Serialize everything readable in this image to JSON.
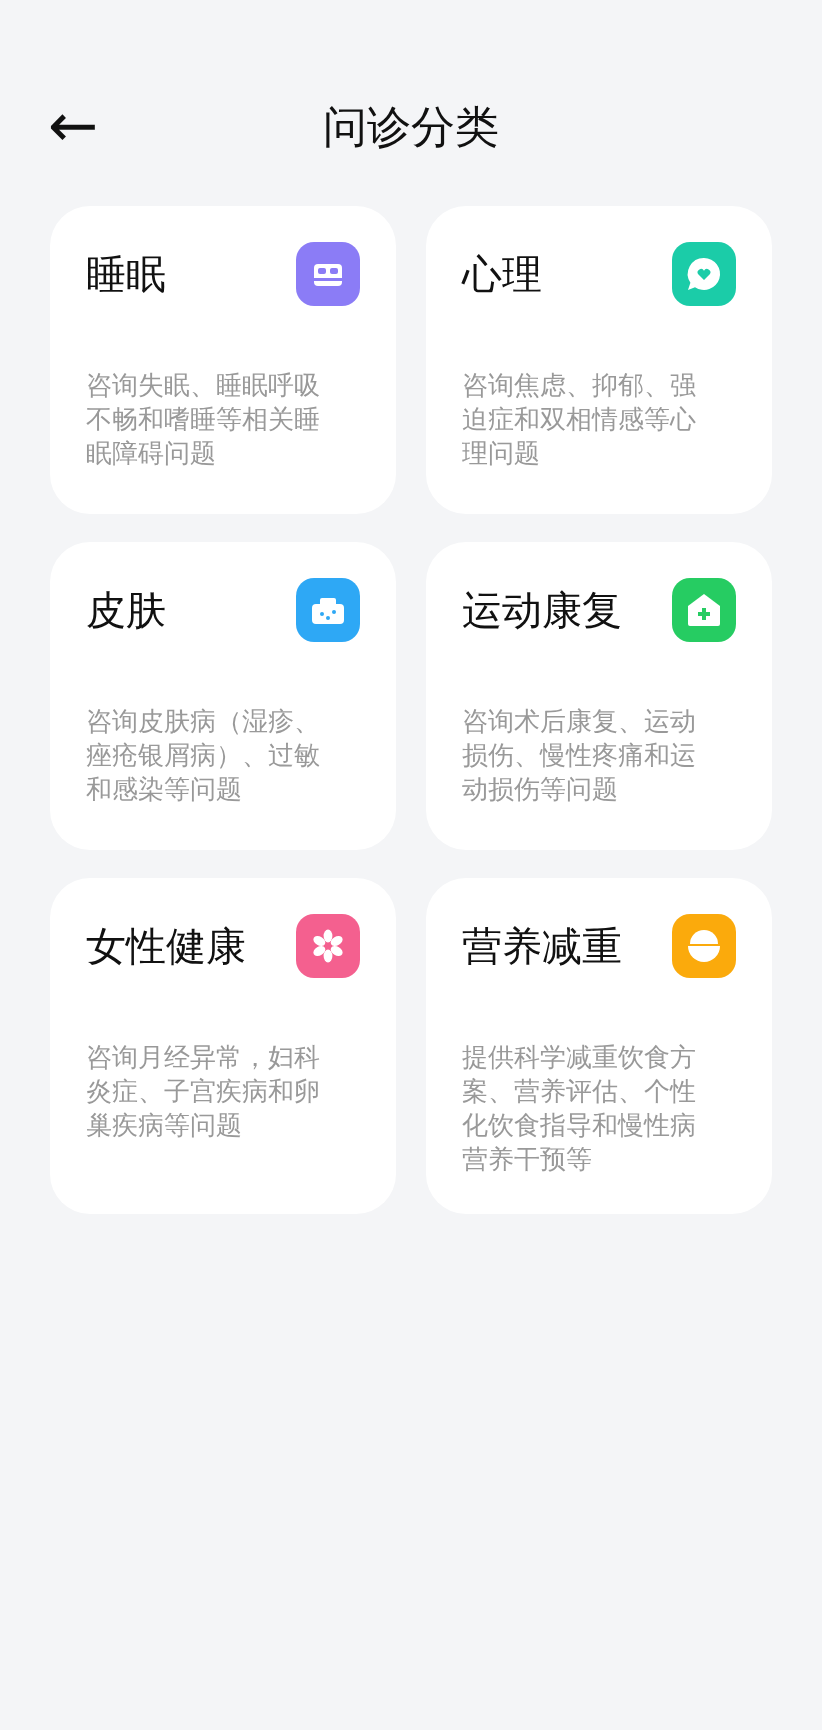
{
  "header": {
    "back_icon": "←",
    "title": "问诊分类"
  },
  "categories": [
    {
      "name": "睡眠",
      "description": "咨询失眠、睡眠呼吸不畅和嗜睡等相关睡眠障碍问题",
      "kind": "bed",
      "color": "#8b7cf6"
    },
    {
      "name": "心理",
      "description": "咨询焦虑、抑郁、强迫症和双相情感等心理问题",
      "kind": "chat",
      "color": "#1bcca8"
    },
    {
      "name": "皮肤",
      "description": "咨询皮肤病（湿疹、痤疮银屑病）、过敏和感染等问题",
      "kind": "case",
      "color": "#2ea8f5"
    },
    {
      "name": "运动康复",
      "description": "咨询术后康复、运动损伤、慢性疼痛和运动损伤等问题",
      "kind": "house",
      "color": "#26cc62"
    },
    {
      "name": "女性健康",
      "description": "咨询月经异常，妇科炎症、子宫疾病和卵巢疾病等问题",
      "kind": "flower",
      "color": "#f4608f"
    },
    {
      "name": "营养减重",
      "description": "提供科学减重饮食方案、营养评估、个性化饮食指导和慢性病营养干预等",
      "kind": "bowl",
      "color": "#fbaa0c"
    }
  ]
}
